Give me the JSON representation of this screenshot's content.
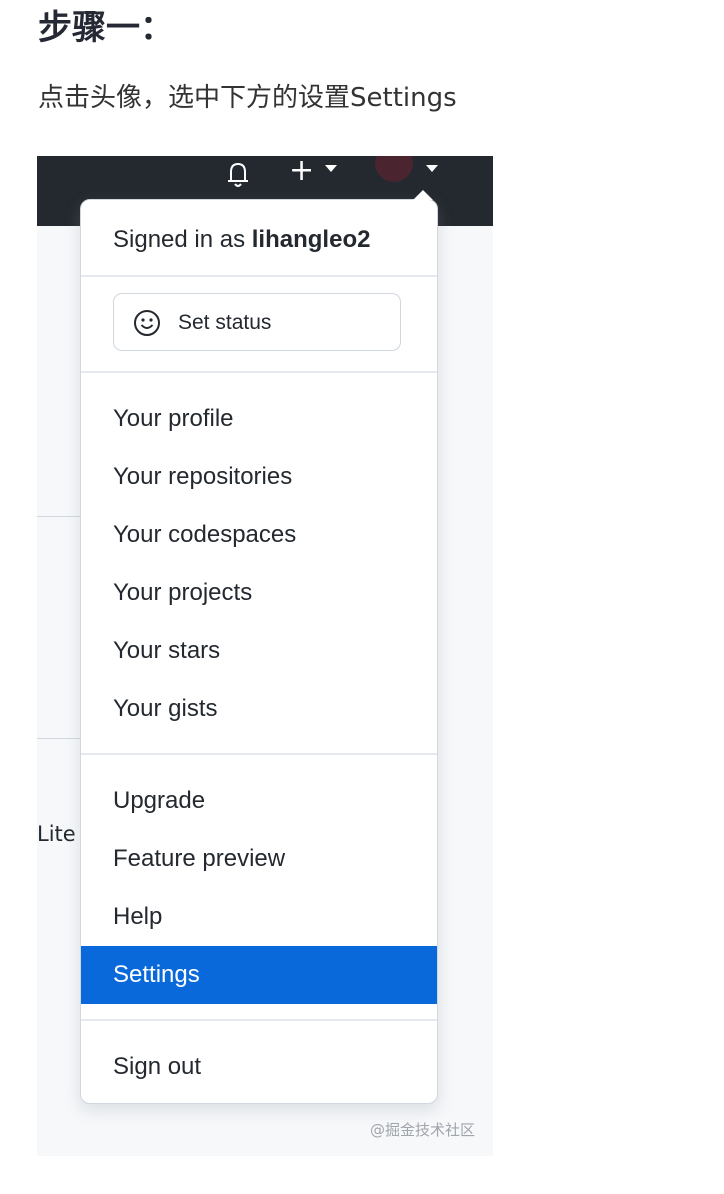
{
  "heading": "步骤一：",
  "instruction": "点击头像，选中下方的设置Settings",
  "header": {
    "icons": [
      "bell-icon",
      "plus-icon",
      "caret-down-icon",
      "avatar",
      "caret-down-icon"
    ],
    "plus_symbol": "+"
  },
  "background_fragment": {
    "text": "Lite"
  },
  "menu": {
    "signed_in_prefix": "Signed in as",
    "username": "lihangleo2",
    "set_status_label": "Set status",
    "group1": [
      "Your profile",
      "Your repositories",
      "Your codespaces",
      "Your projects",
      "Your stars",
      "Your gists"
    ],
    "group2": [
      "Upgrade",
      "Feature preview",
      "Help",
      "Settings"
    ],
    "sign_out": "Sign out",
    "highlighted_item": "Settings",
    "highlight_color": "#0969da"
  },
  "watermark": "@掘金技术社区"
}
